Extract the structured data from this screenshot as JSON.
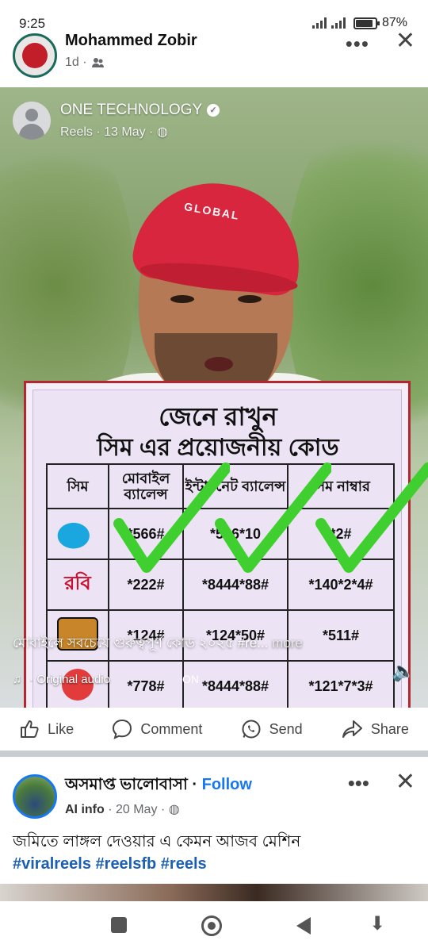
{
  "status_bar": {
    "time": "9:25",
    "battery_pct": "87%",
    "battery_level": 0.87
  },
  "post1": {
    "author": "Mohammed Zobir",
    "time": "1d ·",
    "audience_icon": "friends-icon",
    "menu_label": "•••",
    "close_label": "✕"
  },
  "reel": {
    "author": "ONE TECHNOLOGY",
    "sub": "Reels · 13 May ·",
    "cap_text": "GLOBAL",
    "card": {
      "title1": "জেনে রাখুন",
      "title2": "সিম এর প্রয়োজনীয় কোড",
      "headers": [
        "সিম",
        "মোবাইল ব্যালেন্স",
        "ইন্টারনেট ব্যালেন্স",
        "সিম নাম্বার"
      ],
      "rows": [
        {
          "operator": "grameenphone-logo",
          "balance": "*566#",
          "internet": "*566*10",
          "number": "*2#"
        },
        {
          "operator": "রবি",
          "balance": "*222#",
          "internet": "*8444*88#",
          "number": "*140*2*4#"
        },
        {
          "operator": "banglalink-logo",
          "balance": "*124#",
          "internet": "*124*50#",
          "number": "*511#"
        },
        {
          "operator": "airtel-logo",
          "balance": "*778#",
          "internet": "*8444*88#",
          "number": "*121*7*3#"
        }
      ]
    },
    "caption": "মোবাইলে সবচেয়ে গুরুত্বপূর্ণ কোড ২০২৫ #re...",
    "caption_more": " more",
    "audio": "· Original audio",
    "on_label": "ON"
  },
  "actions": {
    "like": "Like",
    "comment": "Comment",
    "send": "Send",
    "share": "Share"
  },
  "post2": {
    "author": "অসমাপ্ত ভালোবাসা",
    "follow": "Follow",
    "meta_ai": "AI info",
    "meta_rest": " · 20 May ·",
    "text": "জমিতে লাঙ্গল দেওয়ার এ কেমন আজব মেশিন",
    "tags": "#viralreels #reelsfb #reels",
    "menu_label": "•••",
    "close_label": "✕"
  },
  "colors": {
    "brand_blue": "#1877f2",
    "tick_green": "#3fcf2f",
    "card_border": "#b52630"
  }
}
